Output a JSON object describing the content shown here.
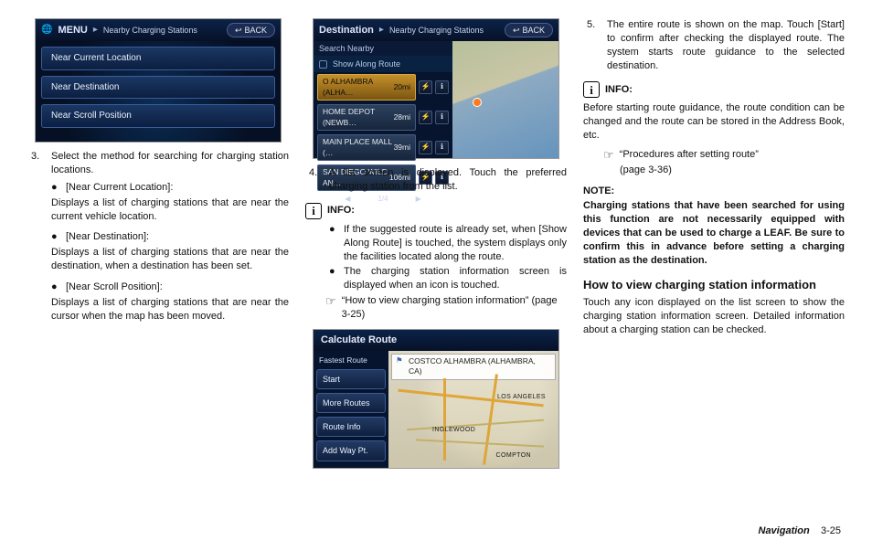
{
  "screens": {
    "menu": {
      "title_main": "MENU",
      "title_sep": "▸",
      "title_sub": "Nearby Charging Stations",
      "back": "BACK",
      "rows": [
        "Near Current Location",
        "Near Destination",
        "Near Scroll Position"
      ]
    },
    "dest": {
      "title_main": "Destination",
      "title_sep": "▸",
      "title_sub": "Nearby Charging Stations",
      "back": "BACK",
      "search_nearby": "Search Nearby",
      "show_along": "Show Along Route",
      "page_indicator": "1/4",
      "items": [
        {
          "name": "O ALHAMBRA (ALHA…",
          "dist": "20mi",
          "selected": true
        },
        {
          "name": "HOME DEPOT (NEWB…",
          "dist": "28mi",
          "selected": false
        },
        {
          "name": "MAIN PLACE MALL (…",
          "dist": "39mi",
          "selected": false
        },
        {
          "name": "SAN DIEGO WILD AN…",
          "dist": "106mi",
          "selected": false
        }
      ]
    },
    "route": {
      "title": "Calculate Route",
      "tag": "Fastest Route",
      "flag": "COSTCO ALHAMBRA (ALHAMBRA, CA)",
      "buttons": [
        "Start",
        "More Routes",
        "Route Info",
        "Add Way Pt."
      ],
      "labels": {
        "la": "LOS ANGELES",
        "ing": "INGLEWOOD",
        "comp": "COMPTON"
      }
    }
  },
  "col1": {
    "step3_n": "3.",
    "step3": "Select the method for searching for charging station locations.",
    "b1_label": "[Near Current Location]:",
    "b1_body": "Displays a list of charging stations that are near the current vehicle location.",
    "b2_label": "[Near Destination]:",
    "b2_body": "Displays a list of charging stations that are near the destination, when a destination has been set.",
    "b3_label": "[Near Scroll Position]:",
    "b3_body": "Displays a list of charging stations that are near the cursor when the map has been moved."
  },
  "col2": {
    "step4_n": "4.",
    "step4": "A list screen is displayed. Touch the preferred charging station from the list.",
    "info_label": "INFO:",
    "i1": "If the suggested route is already set, when [Show Along Route] is touched, the system displays only the facilities located along the route.",
    "i2": "The charging station information screen is displayed when an icon is touched.",
    "ref_text": "“How to view charging station information” (page 3-25)"
  },
  "col3": {
    "step5_n": "5.",
    "step5": "The entire route is shown on the map. Touch [Start] to confirm after checking the displayed route. The system starts route guidance to the selected destination.",
    "info_label": "INFO:",
    "info_body": "Before starting route guidance, the route condition can be changed and the route can be stored in the Address Book, etc.",
    "ref_text": "“Procedures after setting route”",
    "ref_page": "(page 3-36)",
    "note_label": "NOTE:",
    "note_body": "Charging stations that have been searched for using this function are not necessarily equipped with devices that can be used to charge a LEAF. Be sure to confirm this in advance before setting a charging station as the destination.",
    "h2": "How to view charging station information",
    "h2_body": "Touch any icon displayed on the list screen to show the charging station information screen. Detailed information about a charging station can be checked."
  },
  "footer": {
    "section": "Navigation",
    "page": "3-25"
  }
}
